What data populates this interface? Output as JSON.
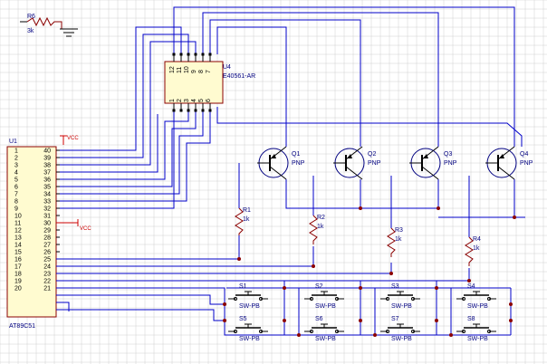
{
  "colors": {
    "grid": "#d0d0d0",
    "wire": "#0000c8",
    "component": "#8b0000",
    "ic_body": "#fffbd0",
    "label": "#000080",
    "power": "#cc0000",
    "junction": "#8b0000"
  },
  "r6": {
    "ref": "R6",
    "value": "3k"
  },
  "u4": {
    "ref": "U4",
    "part": "E40561-AR",
    "top_pins": [
      "12",
      "11",
      "10",
      "9",
      "8",
      "7"
    ],
    "bottom_pins": [
      "1",
      "2",
      "3",
      "4",
      "5",
      "6"
    ]
  },
  "u1": {
    "ref": "U1",
    "part": "AT89C51",
    "left_pins": [
      "1",
      "2",
      "3",
      "4",
      "5",
      "6",
      "7",
      "8",
      "9",
      "10",
      "11",
      "12",
      "13",
      "14",
      "15",
      "16",
      "17",
      "18",
      "19",
      "20"
    ],
    "right_pins": [
      "40",
      "39",
      "38",
      "37",
      "36",
      "35",
      "34",
      "33",
      "32",
      "31",
      "30",
      "29",
      "28",
      "27",
      "26",
      "25",
      "24",
      "23",
      "22",
      "21"
    ]
  },
  "power": {
    "vcc": "VCC"
  },
  "transistors": [
    {
      "ref": "Q1",
      "type": "PNP"
    },
    {
      "ref": "Q2",
      "type": "PNP"
    },
    {
      "ref": "Q3",
      "type": "PNP"
    },
    {
      "ref": "Q4",
      "type": "PNP"
    }
  ],
  "resistors": [
    {
      "ref": "R1",
      "value": "1k"
    },
    {
      "ref": "R2",
      "value": "1k"
    },
    {
      "ref": "R3",
      "value": "1k"
    },
    {
      "ref": "R4",
      "value": "1k"
    }
  ],
  "switches": [
    {
      "ref": "S1",
      "part": "SW-PB"
    },
    {
      "ref": "S2",
      "part": "SW-PB"
    },
    {
      "ref": "S3",
      "part": "SW-PB"
    },
    {
      "ref": "S4",
      "part": "SW-PB"
    },
    {
      "ref": "S5",
      "part": "SW-PB"
    },
    {
      "ref": "S6",
      "part": "SW-PB"
    },
    {
      "ref": "S7",
      "part": "SW-PB"
    },
    {
      "ref": "S8",
      "part": "SW-PB"
    }
  ]
}
